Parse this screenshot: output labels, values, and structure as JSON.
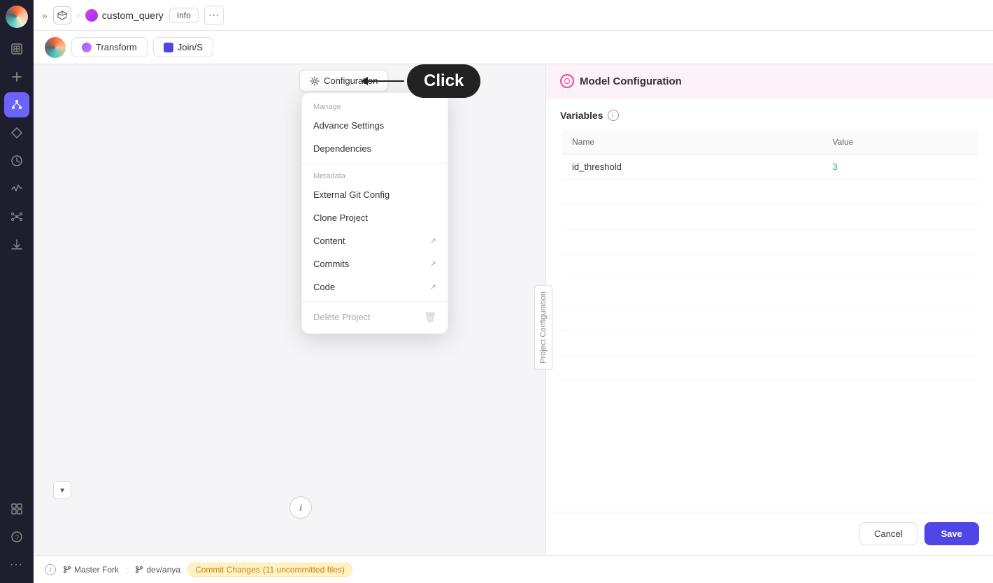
{
  "sidebar": {
    "icons": [
      {
        "name": "logo",
        "symbol": "●"
      },
      {
        "name": "photos",
        "symbol": "⊞"
      },
      {
        "name": "add",
        "symbol": "+"
      },
      {
        "name": "diagram",
        "symbol": "⬡"
      },
      {
        "name": "diamond",
        "symbol": "◆"
      },
      {
        "name": "clock",
        "symbol": "◷"
      },
      {
        "name": "activity",
        "symbol": "⌇"
      },
      {
        "name": "network",
        "symbol": "⚏"
      },
      {
        "name": "download",
        "symbol": "↓"
      },
      {
        "name": "grid-bottom",
        "symbol": "⊞"
      },
      {
        "name": "help",
        "symbol": "?"
      },
      {
        "name": "more",
        "symbol": "···"
      }
    ]
  },
  "topbar": {
    "chevron": "»",
    "project_icon": "⬡",
    "project_name": "custom_query",
    "info_label": "Info",
    "more_symbol": "···"
  },
  "subtopbar": {
    "tabs": [
      {
        "label": "Transform",
        "color": "#a855f7"
      },
      {
        "label": "Join/S",
        "color": "#4f46e5"
      }
    ]
  },
  "click_tooltip": {
    "label": "Click"
  },
  "config_trigger": {
    "icon": "⚙",
    "label": "Configuration"
  },
  "dropdown": {
    "manage_section": "Manage",
    "metadata_section": "Metadata",
    "items_manage": [
      {
        "label": "Advance Settings",
        "has_arrow": false
      },
      {
        "label": "Dependencies",
        "has_arrow": false
      }
    ],
    "items_metadata": [
      {
        "label": "External Git Config",
        "has_arrow": false
      },
      {
        "label": "Clone Project",
        "has_arrow": false
      },
      {
        "label": "Content",
        "has_arrow": true
      },
      {
        "label": "Commits",
        "has_arrow": true
      },
      {
        "label": "Code",
        "has_arrow": true
      }
    ],
    "delete_label": "Delete Project"
  },
  "vertical_tab": {
    "label": "Project Configuration"
  },
  "right_panel": {
    "header": {
      "title": "Model Configuration",
      "icon_color": "#ec4899"
    },
    "variables": {
      "title": "Variables",
      "table": {
        "headers": [
          "Name",
          "Value"
        ],
        "rows": [
          {
            "name": "id_threshold",
            "value": "3",
            "value_color": "#22c55e"
          }
        ],
        "empty_rows": 10
      }
    },
    "footer": {
      "cancel_label": "Cancel",
      "save_label": "Save"
    }
  },
  "bottom_bar": {
    "branch_master": "Master Fork",
    "branch_dev": "dev/anya",
    "commit_label": "Commit Changes",
    "uncommitted": "(11 uncommitted files)"
  },
  "center_info": {
    "symbol": "i"
  }
}
